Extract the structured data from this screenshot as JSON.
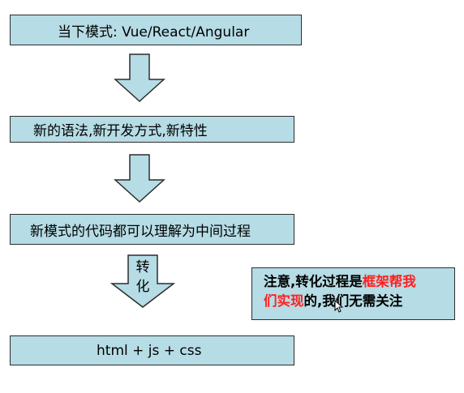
{
  "boxes": {
    "step1": "当下模式: Vue/React/Angular",
    "step2": "新的语法,新开发方式,新特性",
    "step3": "新模式的代码都可以理解为中间过程",
    "step4": "html  + js  + css"
  },
  "arrow_label": {
    "line1": "转",
    "line2": "化"
  },
  "note": {
    "part1": "注意,转化过程是",
    "highlight1": "框架帮我",
    "highlight2": "们实现",
    "part2": "的,我们无需关注"
  },
  "colors": {
    "box_fill": "#b6dce5",
    "border": "#2d2d2d",
    "highlight_text": "#ff2020"
  }
}
